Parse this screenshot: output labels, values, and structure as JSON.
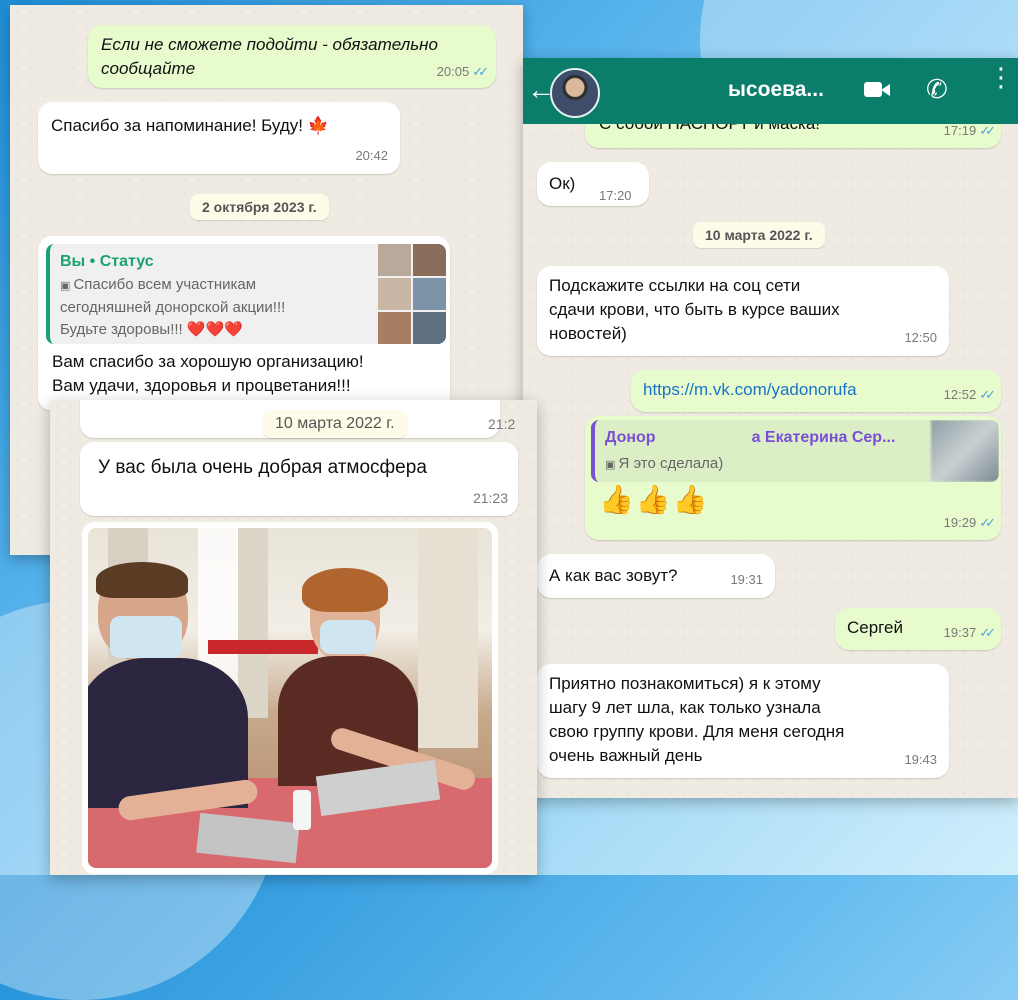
{
  "left_panel": {
    "msg_reminder": {
      "text": "Если не сможете подойти - обязательно сообщайте",
      "time": "20:05"
    },
    "msg_thanks": {
      "text": "Спасибо за напоминание! Буду!",
      "time": "20:42"
    },
    "date_divider": "2 октября 2023 г.",
    "reply": {
      "author": "Вы • Статус",
      "quote_line1": "Спасибо всем участникам",
      "quote_line2": "сегодняшней донорской акции!!!",
      "quote_line3": "Будьте здоровы!!! ❤️❤️❤️",
      "body_line1": "Вам спасибо за хорошую организацию!",
      "body_line2": "Вам удачи, здоровья и процветания!!!"
    }
  },
  "bottom_panel": {
    "date_divider": "10 марта 2022 г.",
    "partial_time": "21:2",
    "msg_atmosphere": {
      "text": "У вас была очень добрая атмосфера",
      "time": "21:23"
    }
  },
  "right_panel": {
    "header": {
      "contact_name": "ысоева..."
    },
    "msg_passport": {
      "text": "С собой ПАСПОРТ и маска!",
      "time": "17:19"
    },
    "msg_ok": {
      "text": "Ок)",
      "time": "17:20"
    },
    "date_divider": "10 марта 2022 г.",
    "msg_links": {
      "line1": "Подскажите ссылки на соц сети",
      "line2": "сдачи крови, что быть в курсе ваших",
      "line3": "новостей)",
      "time": "12:50"
    },
    "msg_url": {
      "text": "https://m.vk.com/yadonorufa",
      "time": "12:52"
    },
    "msg_reply": {
      "author_a": "Донор",
      "author_b": "а Екатерина Сер...",
      "quote": "Я это сделала)",
      "emoji": "👍👍👍",
      "time": "19:29"
    },
    "msg_name_q": {
      "text": "А как вас зовут?",
      "time": "19:31"
    },
    "msg_name": {
      "text": "Сергей",
      "time": "19:37"
    },
    "msg_final": {
      "line1": "Приятно познакомиться) я к этому",
      "line2": "шагу 9 лет шла, как только узнала",
      "line3": "свою группу крови. Для меня сегодня",
      "line4": "очень важный день",
      "time": "19:43"
    }
  },
  "colors": {
    "header_green": "#0b7d6b",
    "outgoing_bubble": "#e7fbcc",
    "chat_bg": "#efeae2",
    "link_blue": "#1a73c8",
    "tick_blue": "#4fa3e0"
  }
}
